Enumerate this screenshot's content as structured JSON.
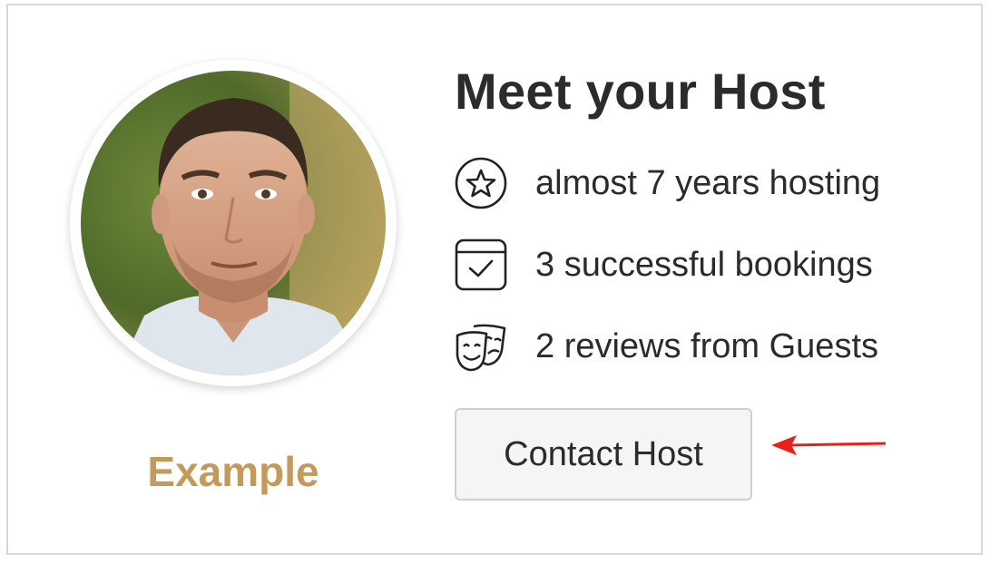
{
  "card": {
    "title": "Meet your Host",
    "host_name": "Example",
    "host_name_color": "#c49a5b",
    "stats": [
      {
        "icon": "star-badge-icon",
        "label": "almost 7 years hosting"
      },
      {
        "icon": "calendar-check-icon",
        "label": "3 successful bookings"
      },
      {
        "icon": "theater-masks-icon",
        "label": "2 reviews from Guests"
      }
    ],
    "contact_button_label": "Contact Host"
  },
  "annotation": {
    "arrow_color": "#e8201a",
    "points_to": "contact-host-button"
  }
}
